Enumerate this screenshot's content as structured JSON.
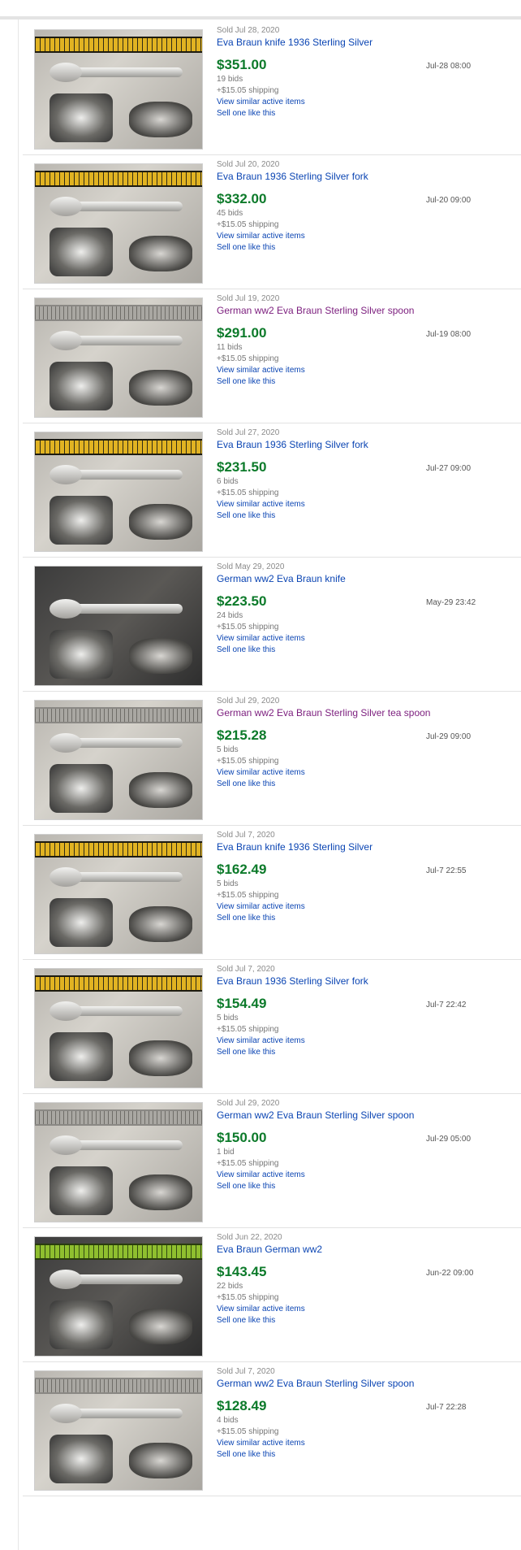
{
  "listings": [
    {
      "sold": "Sold Jul 28, 2020",
      "title": "Eva Braun knife 1936 Sterling Silver",
      "visited": false,
      "price": "$351.00",
      "bids": "19 bids",
      "shipping": "+$15.05 shipping",
      "view_similar": "View similar active items",
      "sell_one": "Sell one like this",
      "end_date": "Jul-28 08:00",
      "image": "ruler-knife",
      "ruler": "yellow"
    },
    {
      "sold": "Sold Jul 20, 2020",
      "title": "Eva Braun 1936 Sterling Silver fork",
      "visited": false,
      "price": "$332.00",
      "bids": "45 bids",
      "shipping": "+$15.05 shipping",
      "view_similar": "View similar active items",
      "sell_one": "Sell one like this",
      "end_date": "Jul-20 09:00",
      "image": "ruler-fork",
      "ruler": "yellow"
    },
    {
      "sold": "Sold Jul 19, 2020",
      "title": "German ww2 Eva Braun Sterling Silver spoon",
      "visited": true,
      "price": "$291.00",
      "bids": "11 bids",
      "shipping": "+$15.05 shipping",
      "view_similar": "View similar active items",
      "sell_one": "Sell one like this",
      "end_date": "Jul-19 08:00",
      "image": "spoon",
      "ruler": "grey"
    },
    {
      "sold": "Sold Jul 27, 2020",
      "title": "Eva Braun 1936 Sterling Silver fork",
      "visited": false,
      "price": "$231.50",
      "bids": "6 bids",
      "shipping": "+$15.05 shipping",
      "view_similar": "View similar active items",
      "sell_one": "Sell one like this",
      "end_date": "Jul-27 09:00",
      "image": "ruler-fork",
      "ruler": "yellow"
    },
    {
      "sold": "Sold May 29, 2020",
      "title": "German ww2 Eva Braun knife",
      "visited": false,
      "price": "$223.50",
      "bids": "24 bids",
      "shipping": "+$15.05 shipping",
      "view_similar": "View similar active items",
      "sell_one": "Sell one like this",
      "end_date": "May-29 23:42",
      "image": "knife-dark",
      "ruler": "none"
    },
    {
      "sold": "Sold Jul 29, 2020",
      "title": "German ww2 Eva Braun Sterling Silver tea spoon",
      "visited": true,
      "price": "$215.28",
      "bids": "5 bids",
      "shipping": "+$15.05 shipping",
      "view_similar": "View similar active items",
      "sell_one": "Sell one like this",
      "end_date": "Jul-29 09:00",
      "image": "spoon",
      "ruler": "grey"
    },
    {
      "sold": "Sold Jul 7, 2020",
      "title": "Eva Braun knife 1936 Sterling Silver",
      "visited": false,
      "price": "$162.49",
      "bids": "5 bids",
      "shipping": "+$15.05 shipping",
      "view_similar": "View similar active items",
      "sell_one": "Sell one like this",
      "end_date": "Jul-7 22:55",
      "image": "ruler-knife",
      "ruler": "yellow"
    },
    {
      "sold": "Sold Jul 7, 2020",
      "title": "Eva Braun 1936 Sterling Silver fork",
      "visited": false,
      "price": "$154.49",
      "bids": "5 bids",
      "shipping": "+$15.05 shipping",
      "view_similar": "View similar active items",
      "sell_one": "Sell one like this",
      "end_date": "Jul-7 22:42",
      "image": "ruler-fork",
      "ruler": "yellow"
    },
    {
      "sold": "Sold Jul 29, 2020",
      "title": "German ww2 Eva Braun Sterling Silver spoon",
      "visited": false,
      "price": "$150.00",
      "bids": "1 bid",
      "shipping": "+$15.05 shipping",
      "view_similar": "View similar active items",
      "sell_one": "Sell one like this",
      "end_date": "Jul-29 05:00",
      "image": "spoon",
      "ruler": "grey"
    },
    {
      "sold": "Sold Jun 22, 2020",
      "title": "Eva Braun German ww2",
      "visited": false,
      "price": "$143.45",
      "bids": "22 bids",
      "shipping": "+$15.05 shipping",
      "view_similar": "View similar active items",
      "sell_one": "Sell one like this",
      "end_date": "Jun-22 09:00",
      "image": "server-dark",
      "ruler": "green"
    },
    {
      "sold": "Sold Jul 7, 2020",
      "title": "German ww2 Eva Braun Sterling Silver spoon",
      "visited": false,
      "price": "$128.49",
      "bids": "4 bids",
      "shipping": "+$15.05 shipping",
      "view_similar": "View similar active items",
      "sell_one": "Sell one like this",
      "end_date": "Jul-7 22:28",
      "image": "spoon",
      "ruler": "grey"
    }
  ],
  "colors": {
    "price": "#0c7a2a",
    "link": "#0b45b3",
    "visited": "#7b1d7d"
  }
}
